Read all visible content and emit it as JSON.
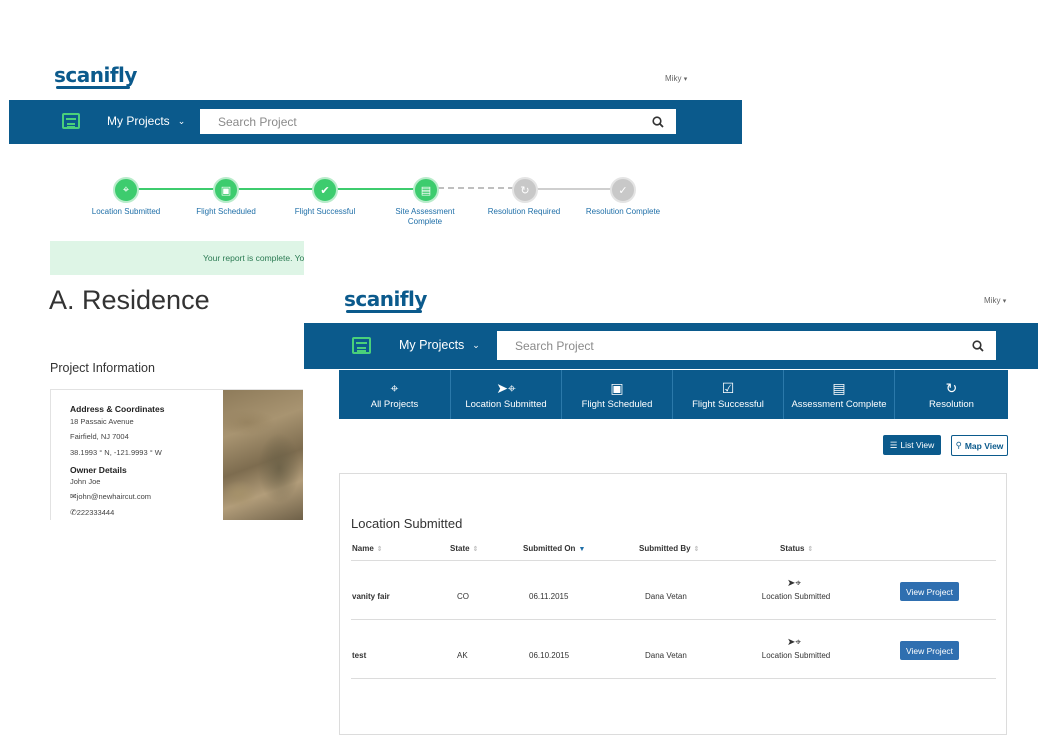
{
  "brand": "scanifly",
  "back_screen": {
    "user": "Miky",
    "nav": {
      "projects_label": "My Projects",
      "search_placeholder": "Search Project"
    },
    "steps": [
      {
        "label": "Location Submitted",
        "state": "complete",
        "icon": "location-pin-icon"
      },
      {
        "label": "Flight Scheduled",
        "state": "complete",
        "icon": "calendar-icon"
      },
      {
        "label": "Flight Successful",
        "state": "complete",
        "icon": "calendar-check-icon"
      },
      {
        "label": "Site Assessment Complete",
        "state": "complete",
        "icon": "document-icon"
      },
      {
        "label": "Resolution Required",
        "state": "pending",
        "icon": "refresh-doc-icon"
      },
      {
        "label": "Resolution Complete",
        "state": "pending",
        "icon": "check-doc-icon"
      }
    ],
    "banner_text": "Your report is complete. Yo",
    "project_title": "A. Residence",
    "section_title": "Project Information",
    "info": {
      "address_heading": "Address & Coordinates",
      "street": "18 Passaic Avenue",
      "city": "Fairfield, NJ 7004",
      "coordinates": "38.1993 ° N, -121.9993 ° W",
      "owner_heading": "Owner Details",
      "owner_name": "John Joe",
      "email": "john@newhaircut.com",
      "phone": "222333444"
    }
  },
  "front_screen": {
    "user": "Miky",
    "nav": {
      "projects_label": "My Projects",
      "search_placeholder": "Search Project"
    },
    "tabs": [
      {
        "label": "All Projects",
        "icon": "map-pin-icon"
      },
      {
        "label": "Location Submitted",
        "icon": "location-pin-icon"
      },
      {
        "label": "Flight Scheduled",
        "icon": "calendar-icon"
      },
      {
        "label": "Flight Successful",
        "icon": "calendar-check-icon"
      },
      {
        "label": "Assessment Complete",
        "icon": "document-icon"
      },
      {
        "label": "Resolution",
        "icon": "refresh-doc-icon"
      }
    ],
    "list_view_label": "List View",
    "map_view_label": "Map View",
    "table_title": "Location Submitted",
    "columns": [
      "Name",
      "State",
      "Submitted On",
      "Submitted By",
      "Status"
    ],
    "rows": [
      {
        "name": "vanity fair",
        "state": "CO",
        "submitted_on": "06.11.2015",
        "submitted_by": "Dana Vetan",
        "status": "Location Submitted",
        "action": "View Project"
      },
      {
        "name": "test",
        "state": "AK",
        "submitted_on": "06.10.2015",
        "submitted_by": "Dana Vetan",
        "status": "Location Submitted",
        "action": "View Project"
      }
    ]
  }
}
